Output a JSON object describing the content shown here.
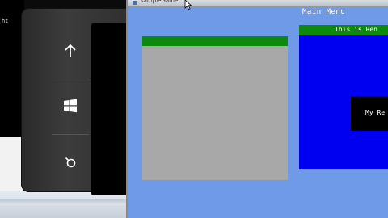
{
  "console": {
    "text": "ht"
  },
  "device": {
    "buttons": [
      {
        "name": "back",
        "icon": "arrow-up-icon"
      },
      {
        "name": "windows",
        "icon": "windows-logo-icon"
      },
      {
        "name": "search",
        "icon": "search-icon"
      }
    ]
  },
  "window": {
    "title": "sampleGame"
  },
  "app": {
    "menu_title": "Main Menu",
    "blue_panel_title": "This is Ren",
    "black_box_text": "My Re"
  },
  "colors": {
    "background": "#6f9ae8",
    "green_header": "#0c8a0c",
    "gray_panel": "#a8a8a8",
    "blue_panel": "#0000f0",
    "black_box": "#000000"
  }
}
